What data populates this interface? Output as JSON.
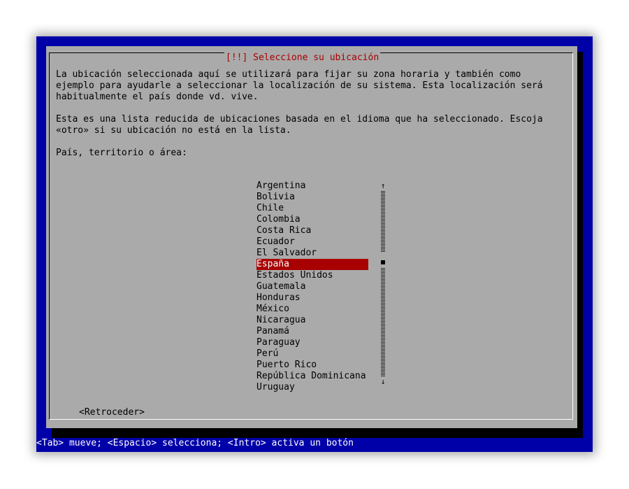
{
  "dialog": {
    "title": "[!!] Seleccione su ubicación",
    "paragraph1_lines": [
      "La ubicación seleccionada aquí se utilizará para fijar su zona horaria y también como",
      "ejemplo para ayudarle a seleccionar la localización de su sistema. Esta localización será",
      "habitualmente el país donde vd. vive."
    ],
    "paragraph2_lines": [
      "Esta es una lista reducida de ubicaciones basada en el idioma que ha seleccionado. Escoja",
      "«otro» si su ubicación no está en la lista."
    ],
    "prompt": "País, territorio o área:",
    "countries": [
      "Argentina",
      "Bolivia",
      "Chile",
      "Colombia",
      "Costa Rica",
      "Ecuador",
      "El Salvador",
      "España",
      "Estados Unidos",
      "Guatemala",
      "Honduras",
      "México",
      "Nicaragua",
      "Panamá",
      "Paraguay",
      "Perú",
      "Puerto Rico",
      "República Dominicana",
      "Uruguay"
    ],
    "selected_country": "España",
    "scroll_up_glyph": "↑",
    "scroll_down_glyph": "↓",
    "back_button": "<Retroceder>"
  },
  "status_bar": "<Tab> mueve; <Espacio> selecciona; <Intro> activa un botón",
  "colors": {
    "background_blue": "#0000a8",
    "dialog_gray": "#aaaaaa",
    "highlight_red": "#a80000"
  }
}
